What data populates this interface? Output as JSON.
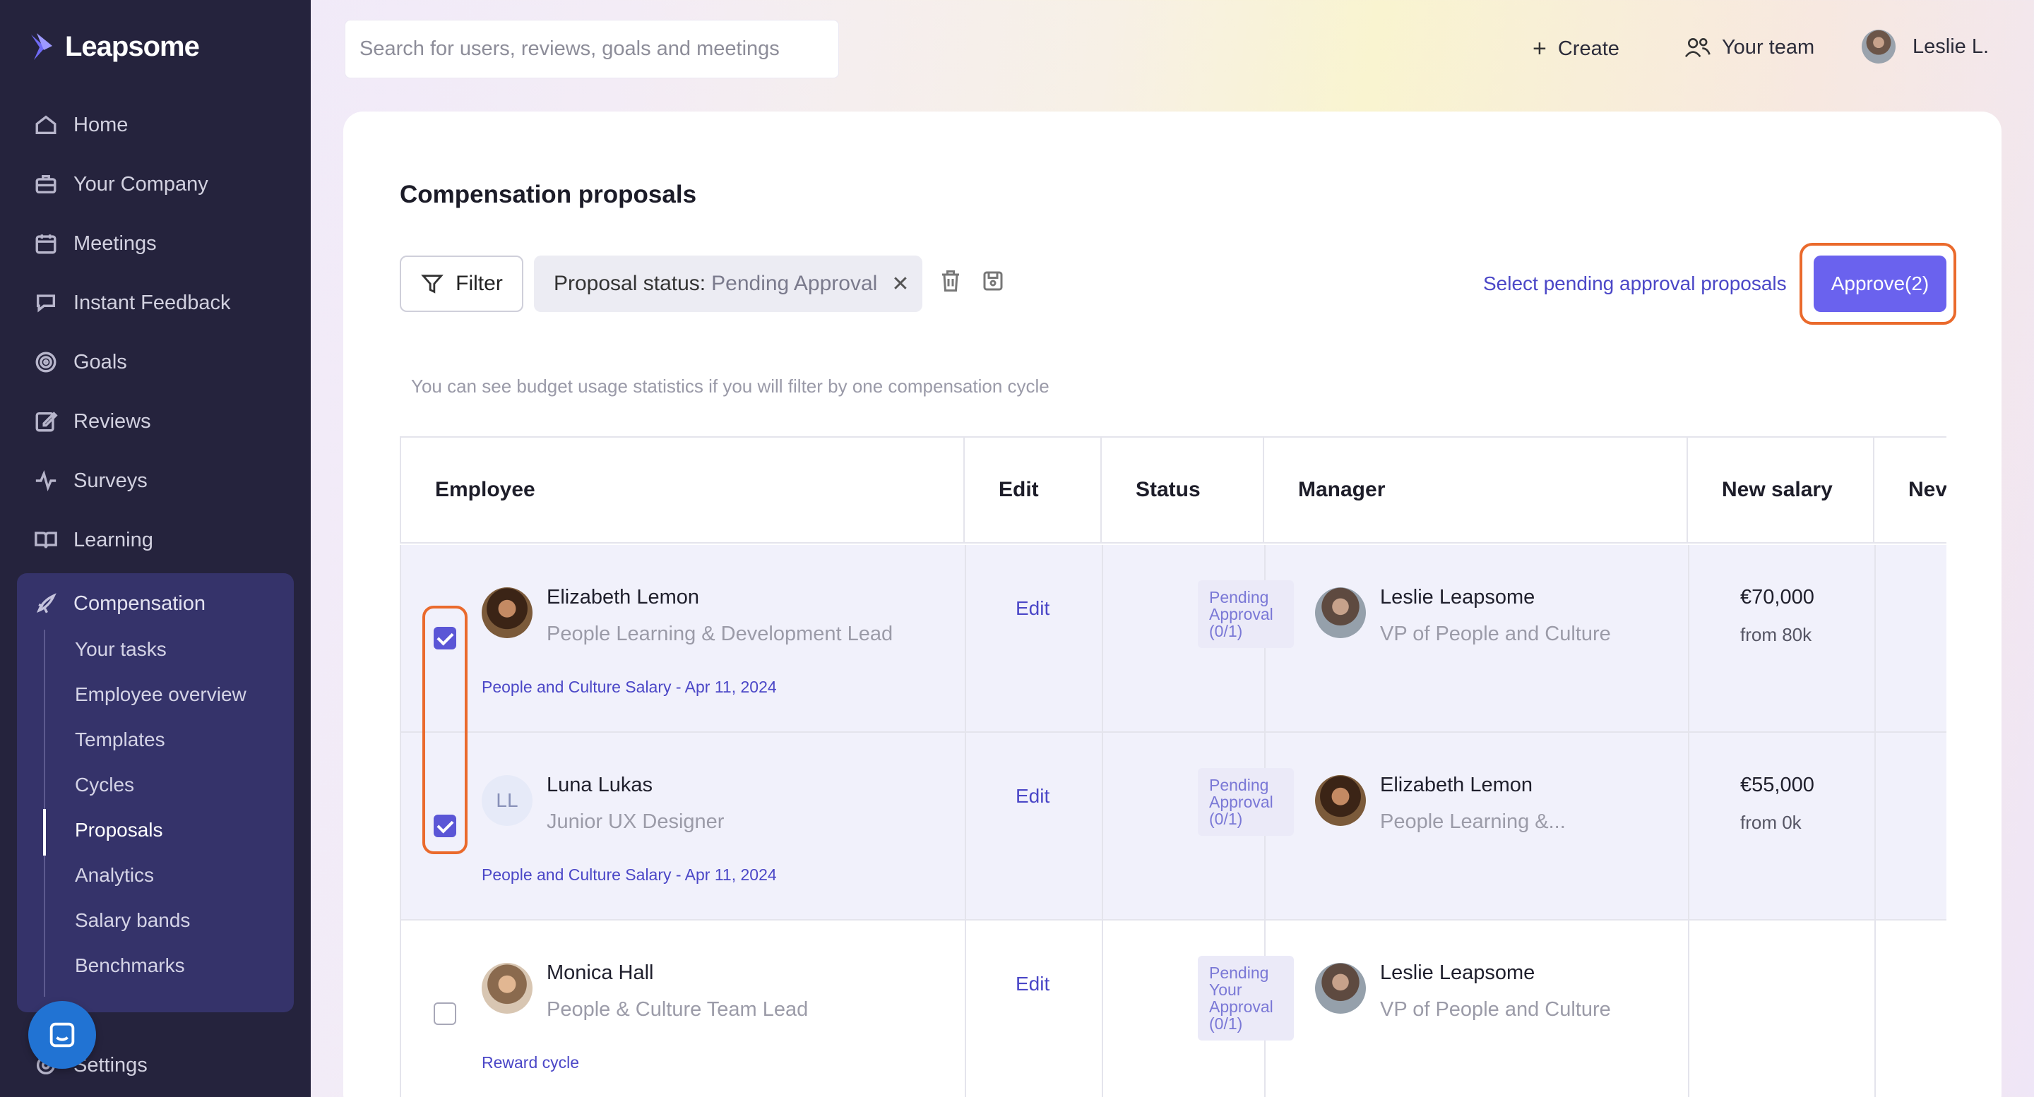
{
  "app": {
    "logo_text": "Leapsome"
  },
  "sidebar": {
    "items": [
      {
        "label": "Home",
        "icon": "home-icon"
      },
      {
        "label": "Your Company",
        "icon": "briefcase-icon"
      },
      {
        "label": "Meetings",
        "icon": "calendar-icon"
      },
      {
        "label": "Instant Feedback",
        "icon": "feedback-icon"
      },
      {
        "label": "Goals",
        "icon": "target-icon"
      },
      {
        "label": "Reviews",
        "icon": "edit-icon"
      },
      {
        "label": "Surveys",
        "icon": "pulse-icon"
      },
      {
        "label": "Learning",
        "icon": "book-icon"
      }
    ],
    "compensation": {
      "label": "Compensation",
      "sub_items": [
        "Your tasks",
        "Employee overview",
        "Templates",
        "Cycles",
        "Proposals",
        "Analytics",
        "Salary bands",
        "Benchmarks"
      ],
      "active": "Proposals"
    },
    "settings_label": "Settings"
  },
  "topbar": {
    "search_placeholder": "Search for users, reviews, goals and meetings",
    "create_label": "Create",
    "team_label": "Your team",
    "user_label": "Leslie L."
  },
  "page": {
    "title": "Compensation proposals",
    "filter_label": "Filter",
    "chip_key": "Proposal status:",
    "chip_value": "Pending Approval",
    "select_link": "Select pending approval proposals",
    "approve_label": "Approve(2)",
    "hint": "You can see budget usage statistics if you will filter by one compensation cycle"
  },
  "table": {
    "headers": [
      "Employee",
      "Edit",
      "Status",
      "Manager",
      "New salary",
      "Nev"
    ],
    "rows": [
      {
        "selected": true,
        "initials": "",
        "name": "Elizabeth Lemon",
        "role": "People Learning & Development Lead",
        "cycle": "People and Culture Salary - Apr 11, 2024",
        "edit": "Edit",
        "status": [
          "Pending",
          "Approval",
          "(0/1)"
        ],
        "manager": "Leslie Leapsome",
        "manager_role": "VP of People and Culture",
        "salary": "€70,000",
        "from": "from 80k"
      },
      {
        "selected": true,
        "initials": "LL",
        "name": "Luna Lukas",
        "role": "Junior UX Designer",
        "cycle": "People and Culture Salary - Apr 11, 2024",
        "edit": "Edit",
        "status": [
          "Pending",
          "Approval",
          "(0/1)"
        ],
        "manager": "Elizabeth Lemon",
        "manager_role": "People Learning &...",
        "salary": "€55,000",
        "from": "from 0k"
      },
      {
        "selected": false,
        "initials": "",
        "name": "Monica Hall",
        "role": "People & Culture Team Lead",
        "cycle": "Reward cycle",
        "edit": "Edit",
        "status": [
          "Pending",
          "Your",
          "Approval",
          "(0/1)"
        ],
        "manager": "Leslie Leapsome",
        "manager_role": "VP of People and Culture",
        "salary": "",
        "from": ""
      }
    ]
  },
  "colors": {
    "accent": "#6a62ee",
    "sidebar_bg": "#25233d",
    "highlight": "#ea6a2c",
    "link": "#4b47c7"
  }
}
